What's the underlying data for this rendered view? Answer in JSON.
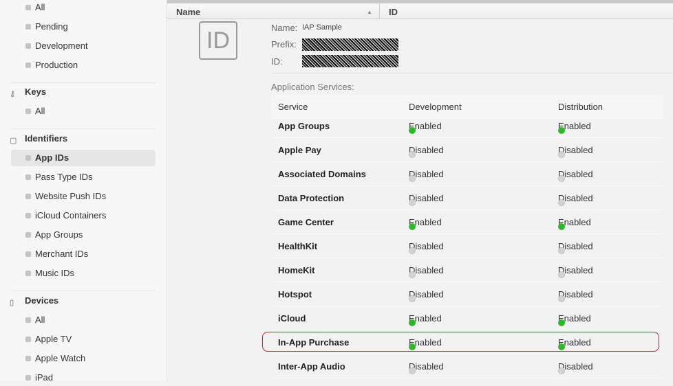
{
  "sidebar": {
    "certificates": [
      "All",
      "Pending",
      "Development",
      "Production"
    ],
    "keys": {
      "title": "Keys",
      "items": [
        "All"
      ]
    },
    "identifiers": {
      "title": "Identifiers",
      "items": [
        "App IDs",
        "Pass Type IDs",
        "Website Push IDs",
        "iCloud Containers",
        "App Groups",
        "Merchant IDs",
        "Music IDs"
      ],
      "selected": "App IDs"
    },
    "devices": {
      "title": "Devices",
      "items": [
        "All",
        "Apple TV",
        "Apple Watch",
        "iPad"
      ]
    }
  },
  "list_header": {
    "name": "Name",
    "id": "ID"
  },
  "detail": {
    "icon_text": "ID",
    "name_label": "Name:",
    "name_value": "IAP Sample",
    "prefix_label": "Prefix:",
    "id_label": "ID:",
    "services_title": "Application Services:",
    "columns": [
      "Service",
      "Development",
      "Distribution"
    ],
    "services": [
      {
        "name": "App Groups",
        "dev": "Enabled",
        "dist": "Enabled"
      },
      {
        "name": "Apple Pay",
        "dev": "Disabled",
        "dist": "Disabled"
      },
      {
        "name": "Associated Domains",
        "dev": "Disabled",
        "dist": "Disabled"
      },
      {
        "name": "Data Protection",
        "dev": "Disabled",
        "dist": "Disabled"
      },
      {
        "name": "Game Center",
        "dev": "Enabled",
        "dist": "Enabled"
      },
      {
        "name": "HealthKit",
        "dev": "Disabled",
        "dist": "Disabled"
      },
      {
        "name": "HomeKit",
        "dev": "Disabled",
        "dist": "Disabled"
      },
      {
        "name": "Hotspot",
        "dev": "Disabled",
        "dist": "Disabled"
      },
      {
        "name": "iCloud",
        "dev": "Enabled",
        "dist": "Enabled"
      },
      {
        "name": "In-App Purchase",
        "dev": "Enabled",
        "dist": "Enabled",
        "highlighted": true
      },
      {
        "name": "Inter-App Audio",
        "dev": "Disabled",
        "dist": "Disabled"
      }
    ]
  },
  "colors": {
    "enabled": "#2db82d",
    "disabled": "#d3d3d3",
    "highlight": "#d0202a"
  }
}
